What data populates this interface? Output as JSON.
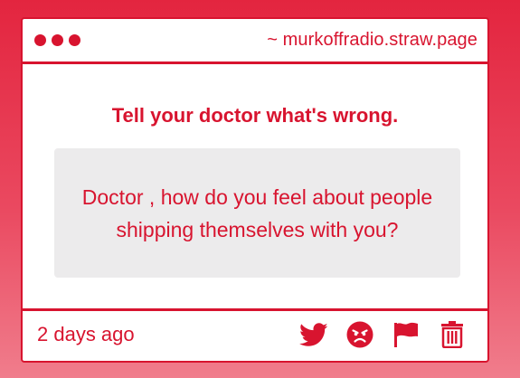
{
  "window": {
    "url": "~ murkoffradio.straw.page"
  },
  "prompt": {
    "headline": "Tell your doctor what's wrong."
  },
  "message": {
    "text": "Doctor , how do you feel about people shipping themselves with you?"
  },
  "footer": {
    "timestamp": "2 days ago",
    "actions": [
      {
        "icon": "twitter-icon"
      },
      {
        "icon": "angry-face-icon"
      },
      {
        "icon": "flag-icon"
      },
      {
        "icon": "trash-icon"
      }
    ]
  },
  "colors": {
    "accent": "#d8142f",
    "bubble": "#ecebec",
    "background_top": "#e3253f",
    "background_bottom": "#f07d8c"
  }
}
